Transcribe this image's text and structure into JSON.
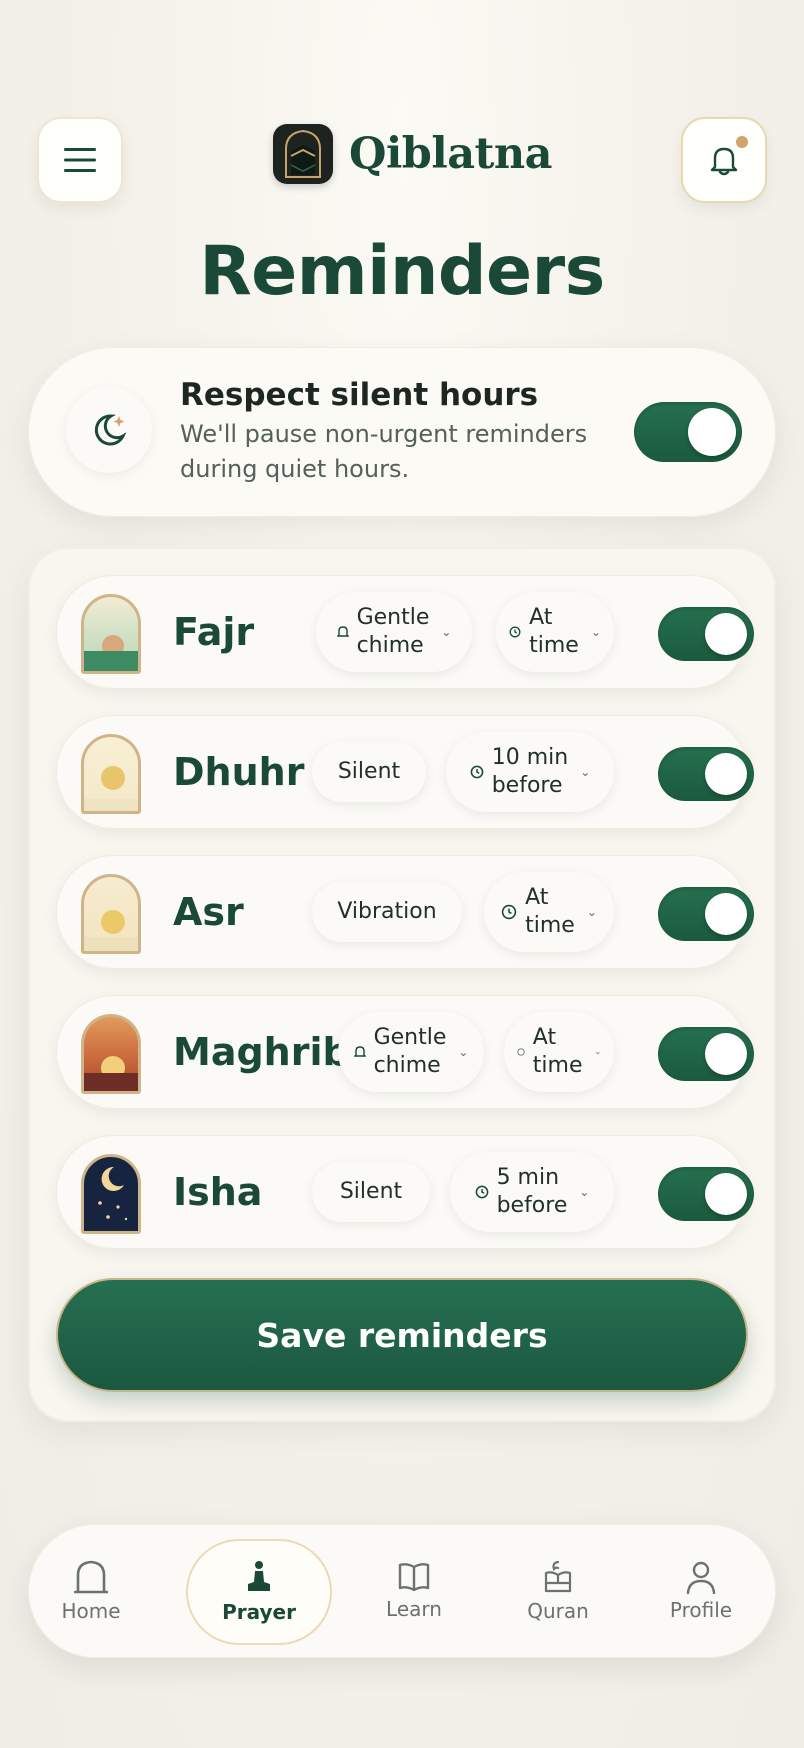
{
  "app": {
    "name": "Qiblatna"
  },
  "header": {
    "title": "Reminders"
  },
  "silent_hours": {
    "title": "Respect silent hours",
    "description": "We'll pause non-urgent reminders during quiet hours.",
    "enabled": true
  },
  "prayers": [
    {
      "name": "Fajr",
      "sound": "Gentle\nchime",
      "sound_icon": "bell-icon",
      "timing": "At\ntime",
      "enabled": true
    },
    {
      "name": "Dhuhr",
      "sound": "Silent",
      "sound_icon": "",
      "timing": "10 min\nbefore",
      "enabled": true
    },
    {
      "name": "Asr",
      "sound": "Vibration",
      "sound_icon": "",
      "timing": "At\ntime",
      "enabled": true
    },
    {
      "name": "Maghrib",
      "sound": "Gentle\nchime",
      "sound_icon": "bell-icon",
      "timing": "At\ntime",
      "enabled": true
    },
    {
      "name": "Isha",
      "sound": "Silent",
      "sound_icon": "",
      "timing": "5 min\nbefore",
      "enabled": true
    }
  ],
  "save_button": {
    "label": "Save reminders"
  },
  "nav": [
    {
      "label": "Home",
      "icon": "mihrab-icon",
      "active": false
    },
    {
      "label": "Prayer",
      "icon": "prayer-mat-icon",
      "active": true
    },
    {
      "label": "Learn",
      "icon": "book-icon",
      "active": false
    },
    {
      "label": "Quran",
      "icon": "quran-stand-icon",
      "active": false
    },
    {
      "label": "Profile",
      "icon": "person-icon",
      "active": false
    }
  ],
  "colors": {
    "primary": "#1a4a37",
    "toggle": "#1f6446",
    "accent_gold": "#d2a36a",
    "background": "#f4f2ea"
  }
}
